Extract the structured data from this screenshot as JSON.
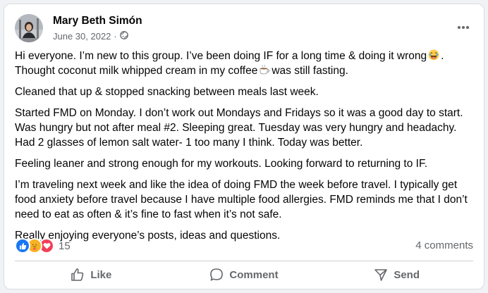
{
  "post": {
    "author": "Mary Beth Simón",
    "date": "June 30, 2022",
    "separator": "·",
    "privacy_icon": "globe-icon",
    "menu_icon": "more-dots-icon"
  },
  "body": {
    "p1a": "Hi everyone. I’m new to this group. I’ve been doing IF for a long time & doing it wrong",
    "p1b": ".",
    "p1c": "Thought coconut milk whipped cream in my coffee",
    "p1d": "was still fasting.",
    "p2": "Cleaned that up & stopped snacking between meals last week.",
    "p3": "Started FMD on Monday. I don’t work out Mondays and Fridays so it was a good day to start. Was hungry but not after meal #2. Sleeping great. Tuesday was very hungry and headachy. Had 2 glasses of lemon salt water- 1 too many I think. Today was better.",
    "p4": "Feeling leaner and strong enough for my workouts. Looking forward to returning to IF.",
    "p5": "I’m traveling next week and like the idea of doing FMD the week before travel. I typically get food anxiety before travel because I have multiple food allergies. FMD reminds me that I don’t need to eat as often & it’s fine to fast when it’s not safe.",
    "p6": "Really enjoying everyone’s posts, ideas and questions.",
    "emoji1": "laughing-face-icon",
    "emoji2": "coffee-icon"
  },
  "stats": {
    "reaction_icons": [
      "like-icon",
      "care-icon",
      "love-icon"
    ],
    "reaction_count": "15",
    "comments": "4 comments"
  },
  "actions": {
    "like": "Like",
    "comment": "Comment",
    "send": "Send"
  },
  "colors": {
    "like_blue": "#1877f2",
    "love_red": "#f33e58",
    "care_yellow": "#f7b125",
    "muted_text": "#65676b"
  }
}
